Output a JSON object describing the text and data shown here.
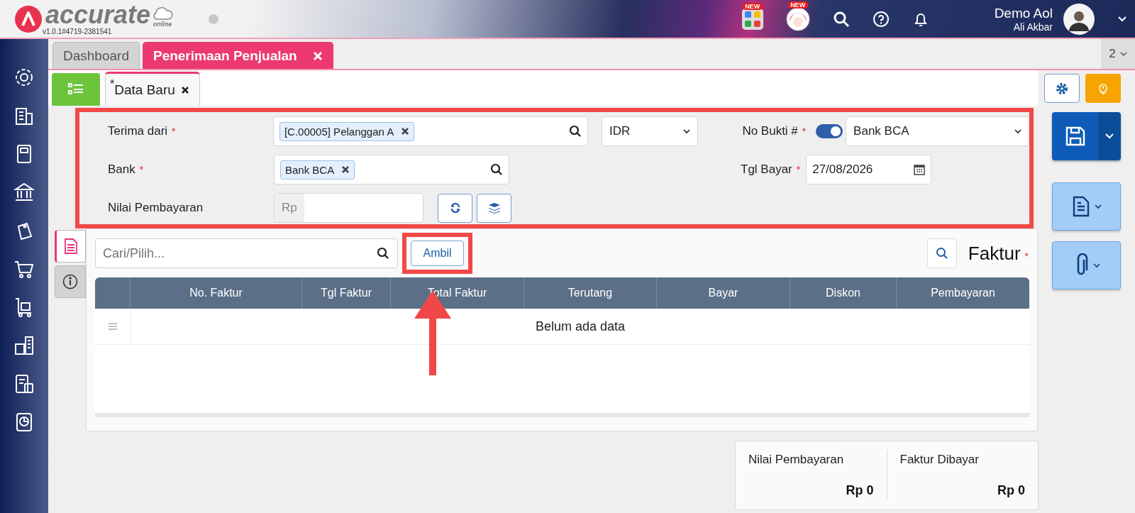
{
  "app": {
    "logo_text": "accurate",
    "logo_sub": "online",
    "version": "v1.0.1#4719-2381541"
  },
  "header_apps": [
    {
      "kind": "apps",
      "badge": "NEW"
    },
    {
      "kind": "mascot",
      "badge": "NEW"
    }
  ],
  "user": {
    "name": "Demo Aol",
    "subtitle": "Ali Akbar"
  },
  "tabs": [
    {
      "label": "Dashboard",
      "selected": false,
      "closable": false
    },
    {
      "label": "Penerimaan Penjualan",
      "selected": true,
      "closable": true
    }
  ],
  "tab_count": "2",
  "subtabs": [
    {
      "label": "Data Baru",
      "marker": "*",
      "closable": true
    }
  ],
  "required_mark": "*",
  "form": {
    "terima_dari": {
      "label": "Terima dari",
      "required": true,
      "tag": "[C.00005] Pelanggan A"
    },
    "currency": "IDR",
    "no_bukti": {
      "label": "No Bukti #",
      "required": true,
      "auto_number": true,
      "value": "Bank BCA"
    },
    "bank": {
      "label": "Bank",
      "required": true,
      "tag": "Bank BCA"
    },
    "tgl_bayar": {
      "label": "Tgl Bayar",
      "required": true,
      "value": "27/08/2026"
    },
    "nilai": {
      "label": "Nilai Pembayaran",
      "required": false,
      "prefix": "Rp"
    }
  },
  "side_tabs": [
    {
      "kind": "document",
      "selected": true
    },
    {
      "kind": "info",
      "selected": false
    }
  ],
  "search": {
    "placeholder": "Cari/Pilih..."
  },
  "ambil_button": "Ambil",
  "section": {
    "title": "Faktur",
    "required": true
  },
  "table": {
    "columns": [
      "No. Faktur",
      "Tgl Faktur",
      "Total Faktur",
      "Terutang",
      "Bayar",
      "Diskon",
      "Pembayaran"
    ],
    "empty_text": "Belum ada data"
  },
  "summary": [
    {
      "label": "Nilai Pembayaran",
      "value": "Rp 0"
    },
    {
      "label": "Faktur Dibayar",
      "value": "Rp 0"
    }
  ]
}
